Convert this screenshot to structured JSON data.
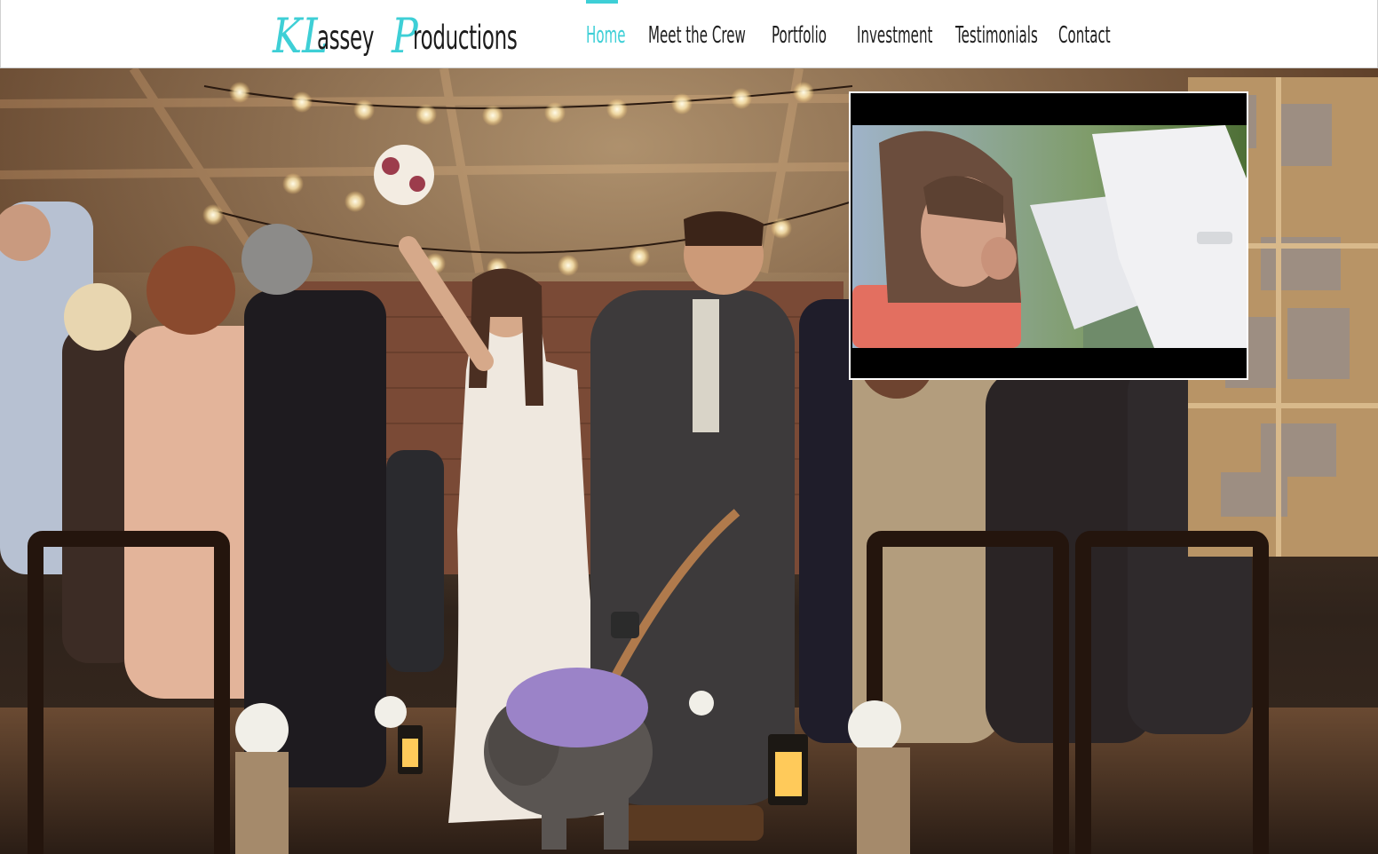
{
  "header": {
    "logo": {
      "cap1": "KL",
      "part1": "assey",
      "cap2": "P",
      "part2": "roductions"
    },
    "nav": [
      {
        "label": "Home",
        "active": true
      },
      {
        "label": "Meet the Crew",
        "active": false
      },
      {
        "label": "Portfolio",
        "active": false
      },
      {
        "label": "Investment",
        "active": false
      },
      {
        "label": "Testimonials",
        "active": false
      },
      {
        "label": "Contact",
        "active": false
      }
    ]
  },
  "colors": {
    "accent": "#3ecfd6",
    "nav_text": "#1e1e1e",
    "video_bg": "#000000"
  },
  "hero": {
    "image": "wedding-recessional-photo"
  },
  "video": {
    "content": "video-player-overlay"
  }
}
